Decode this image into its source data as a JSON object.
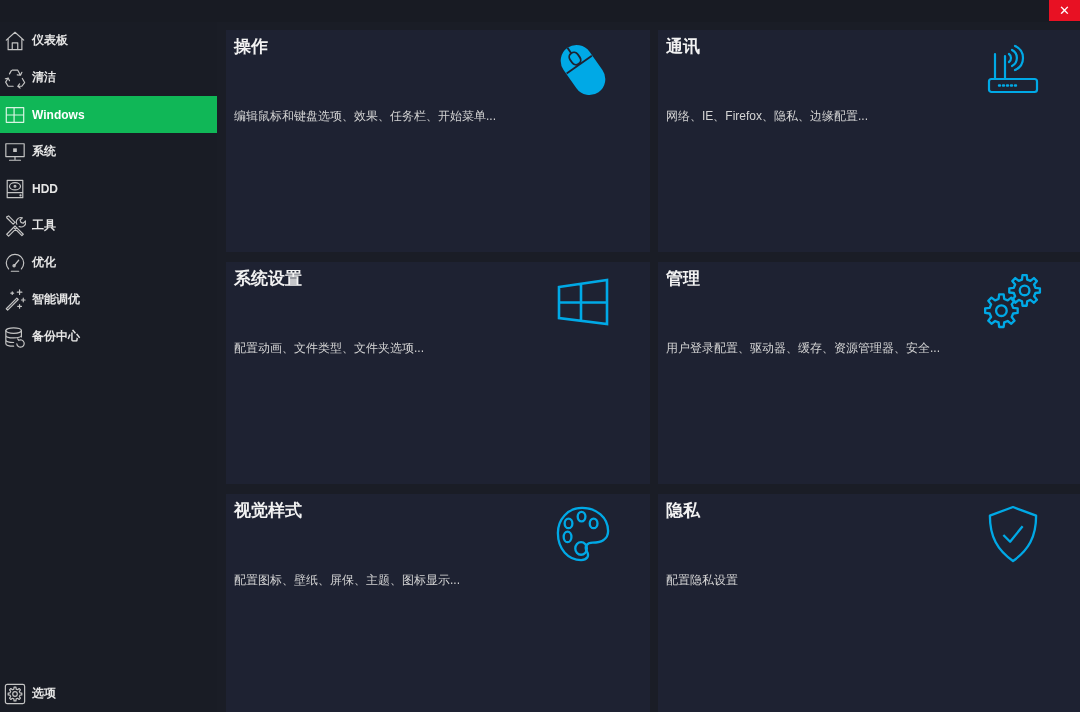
{
  "window": {
    "close_label": "✕"
  },
  "sidebar": {
    "items": [
      {
        "label": "仪表板",
        "selected": false
      },
      {
        "label": "清洁",
        "selected": false
      },
      {
        "label": "Windows",
        "selected": true
      },
      {
        "label": "系统",
        "selected": false
      },
      {
        "label": "HDD",
        "selected": false
      },
      {
        "label": "工具",
        "selected": false
      },
      {
        "label": "优化",
        "selected": false
      },
      {
        "label": "智能调优",
        "selected": false
      },
      {
        "label": "备份中心",
        "selected": false
      }
    ],
    "footer_item": {
      "label": "选项"
    }
  },
  "cards": [
    {
      "title": "操作",
      "description": "编辑鼠标和键盘选项、效果、任务栏、开始菜单..."
    },
    {
      "title": "通讯",
      "description": "网络、IE、Firefox、隐私、边缘配置..."
    },
    {
      "title": "系统设置",
      "description": "配置动画、文件类型、文件夹选项..."
    },
    {
      "title": "管理",
      "description": "用户登录配置、驱动器、缓存、资源管理器、安全..."
    },
    {
      "title": "视觉样式",
      "description": "配置图标、壁纸、屏保、主题、图标显示..."
    },
    {
      "title": "隐私",
      "description": "配置隐私设置"
    }
  ]
}
